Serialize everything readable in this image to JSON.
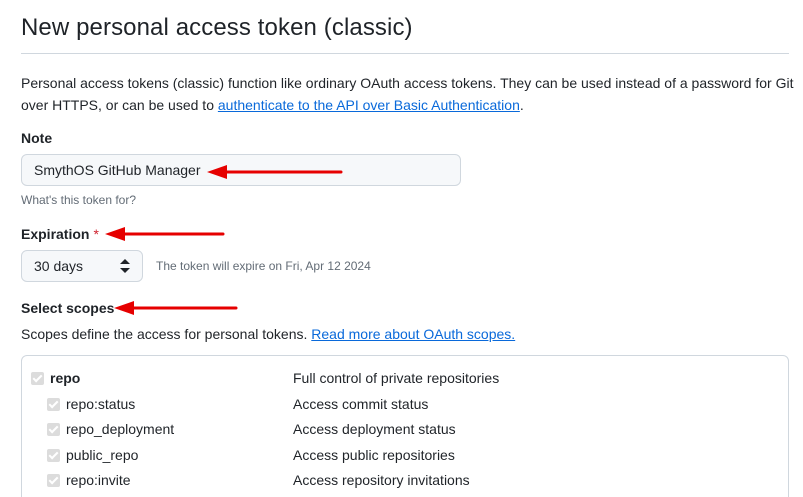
{
  "page": {
    "title": "New personal access token (classic)",
    "intro_text": "Personal access tokens (classic) function like ordinary OAuth access tokens. They can be used instead of a password for Git over HTTPS, or can be used to ",
    "intro_link": "authenticate to the API over Basic Authentication",
    "intro_end": "."
  },
  "note": {
    "label": "Note",
    "value": "SmythOS GitHub Manager",
    "hint": "What's this token for?"
  },
  "expiration": {
    "label": "Expiration",
    "required_mark": "*",
    "selected": "30 days",
    "hint": "The token will expire on Fri, Apr 12 2024"
  },
  "scopes": {
    "label": "Select scopes",
    "description": "Scopes define the access for personal tokens. ",
    "link": "Read more about OAuth scopes.",
    "items": [
      {
        "name": "repo",
        "description": "Full control of private repositories",
        "checked": true
      },
      {
        "name": "repo:status",
        "description": "Access commit status",
        "checked": true
      },
      {
        "name": "repo_deployment",
        "description": "Access deployment status",
        "checked": true
      },
      {
        "name": "public_repo",
        "description": "Access public repositories",
        "checked": true
      },
      {
        "name": "repo:invite",
        "description": "Access repository invitations",
        "checked": true
      }
    ]
  },
  "colors": {
    "link": "#0969da",
    "required": "#cf222e",
    "annotation_arrow": "#e60000"
  }
}
